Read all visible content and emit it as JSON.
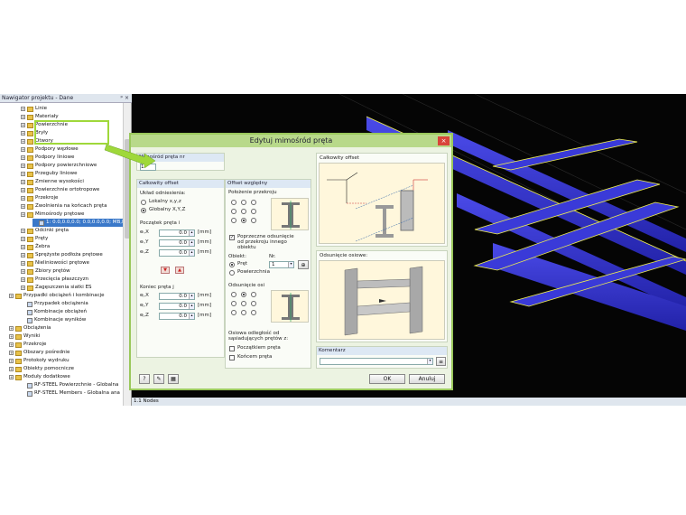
{
  "navigator": {
    "title": "Nawigator projektu - Dane",
    "controls": "ᵖ ×",
    "items": [
      {
        "label": "Linie",
        "indent": 1,
        "icon": "folder"
      },
      {
        "label": "Materiały",
        "indent": 1,
        "icon": "folder"
      },
      {
        "label": "Powierzchnie",
        "indent": 1,
        "icon": "folder"
      },
      {
        "label": "Bryły",
        "indent": 1,
        "icon": "folder"
      },
      {
        "label": "Otwory",
        "indent": 1,
        "icon": "folder"
      },
      {
        "label": "Podpory węzłowe",
        "indent": 1,
        "icon": "folder"
      },
      {
        "label": "Podpory liniowe",
        "indent": 1,
        "icon": "folder"
      },
      {
        "label": "Podpory powierzchniowe",
        "indent": 1,
        "icon": "folder"
      },
      {
        "label": "Przeguby liniowe",
        "indent": 1,
        "icon": "folder"
      },
      {
        "label": "Zmienne wysokości",
        "indent": 1,
        "icon": "folder"
      },
      {
        "label": "Powierzchnie ortotropowe",
        "indent": 1,
        "icon": "folder"
      },
      {
        "label": "Przekroje",
        "indent": 1,
        "icon": "folder"
      },
      {
        "label": "Zwolnienia na końcach pręta",
        "indent": 1,
        "icon": "folder"
      },
      {
        "label": "Mimośrody prętowe",
        "indent": 1,
        "icon": "folder"
      },
      {
        "label": "1: 0.0,0.0,0.0; 0.0,0.0,0.0; MB,M1MT",
        "indent": 2,
        "icon": "item"
      },
      {
        "label": "Odcinki pręta",
        "indent": 1,
        "icon": "folder"
      },
      {
        "label": "Pręty",
        "indent": 1,
        "icon": "folder"
      },
      {
        "label": "Żebra",
        "indent": 1,
        "icon": "folder"
      },
      {
        "label": "Sprężyste podłoża prętowe",
        "indent": 1,
        "icon": "folder"
      },
      {
        "label": "Nieliniowości prętowe",
        "indent": 1,
        "icon": "folder"
      },
      {
        "label": "Zbiory prętów",
        "indent": 1,
        "icon": "folder"
      },
      {
        "label": "Przecięcia płaszczyzn",
        "indent": 1,
        "icon": "folder"
      },
      {
        "label": "Zagęszczenia siatki ES",
        "indent": 1,
        "icon": "folder"
      },
      {
        "label": "Przypadki obciążeń i kombinacje",
        "indent": 0,
        "icon": "folder"
      },
      {
        "label": "Przypadek obciążenia",
        "indent": 1,
        "icon": "item"
      },
      {
        "label": "Kombinacje obciążeń",
        "indent": 1,
        "icon": "item"
      },
      {
        "label": "Kombinacje wyników",
        "indent": 1,
        "icon": "item"
      },
      {
        "label": "Obciążenia",
        "indent": 0,
        "icon": "folder"
      },
      {
        "label": "Wyniki",
        "indent": 0,
        "icon": "folder"
      },
      {
        "label": "Przekroje",
        "indent": 0,
        "icon": "folder"
      },
      {
        "label": "Obszary pośrednie",
        "indent": 0,
        "icon": "folder"
      },
      {
        "label": "Protokoły wydruku",
        "indent": 0,
        "icon": "folder"
      },
      {
        "label": "Obiekty pomocnicze",
        "indent": 0,
        "icon": "folder"
      },
      {
        "label": "Moduły dodatkowe",
        "indent": 0,
        "icon": "folder"
      },
      {
        "label": "RF-STEEL Powierzchnie - Globalna",
        "indent": 1,
        "icon": "item"
      },
      {
        "label": "RF-STEEL Members - Globalna ana",
        "indent": 1,
        "icon": "item"
      }
    ]
  },
  "view": {
    "status": "1.1 Nodes",
    "beam_color": "#3a3ad8",
    "outline_color": "#f0f050"
  },
  "dialog": {
    "title": "Edytuj mimośród pręta",
    "close": "×",
    "nr_header": "Mimośród pręta nr",
    "nr_value": "1",
    "total_offset": {
      "header": "Całkowity offset",
      "ref_label": "Układ odniesienia:",
      "opt_local": "Lokalny x,y,z",
      "opt_global": "Globalny X,Y,Z",
      "start_label": "Początek pręta i",
      "end_label": "Koniec pręta j",
      "rows_start": [
        {
          "label": "eᵢ,X",
          "value": "0.0"
        },
        {
          "label": "eᵢ,Y",
          "value": "0.0"
        },
        {
          "label": "eᵢ,Z",
          "value": "0.0"
        }
      ],
      "rows_end": [
        {
          "label": "eⱼ,X",
          "value": "0.0"
        },
        {
          "label": "eⱼ,Y",
          "value": "0.0"
        },
        {
          "label": "eⱼ,Z",
          "value": "0.0"
        }
      ],
      "unit": "[mm]"
    },
    "relative": {
      "header": "Offset względny",
      "pos_label": "Położenie przekroju",
      "transverse_label": "Poprzeczne odsunięcie od przekroju innego obiektu",
      "object_label": "Obiekt:",
      "nr_label": "Nr.",
      "opt_member": "Pręt",
      "opt_surface": "Powierzchnia",
      "member_nr": "1",
      "axial_label": "Odsunięcie osi",
      "axial_dist_label": "Osiowa odległość od sąsiadujących prętów z:",
      "cb_start": "Początkiem pręta",
      "cb_end": "Końcem pręta"
    },
    "right": {
      "total_header": "Całkowity offset",
      "axial_header": "Odsunięcie osiowe:",
      "comment_header": "Komentarz"
    },
    "ok": "OK",
    "cancel": "Anuluj"
  }
}
